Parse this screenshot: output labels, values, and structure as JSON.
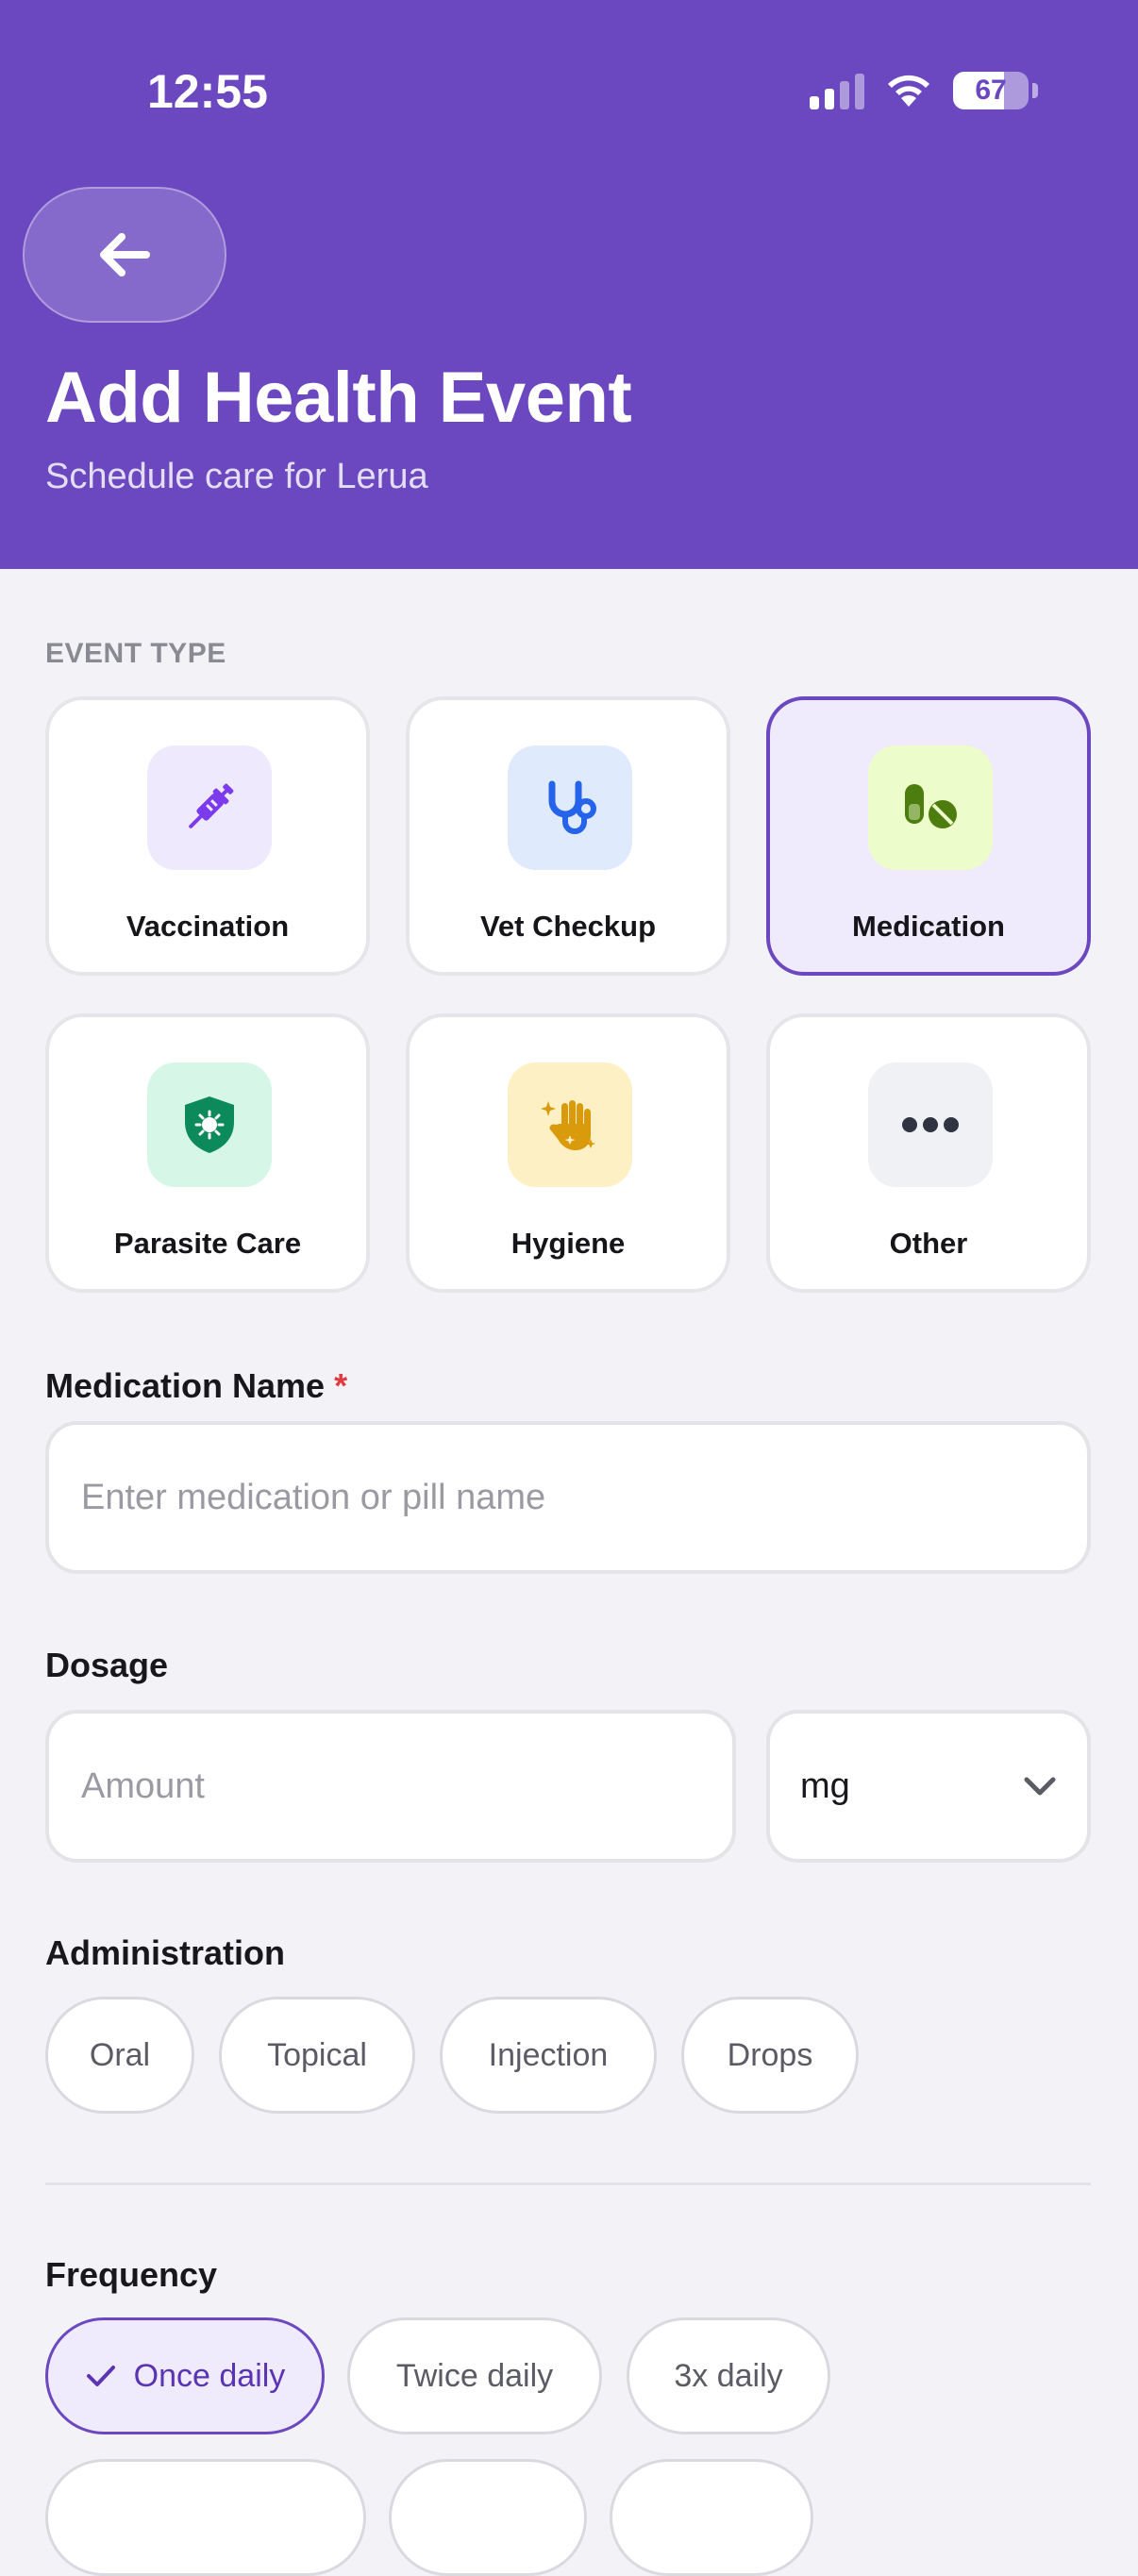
{
  "status_bar": {
    "time": "12:55",
    "battery": "67",
    "battery_level": 0.67
  },
  "header": {
    "title": "Add Health Event",
    "subtitle": "Schedule care for Lerua"
  },
  "event_type": {
    "label": "EVENT TYPE",
    "options": [
      {
        "label": "Vaccination",
        "icon": "syringe-icon",
        "color": "#7c3aed",
        "bg": "#efe9fd",
        "selected": false
      },
      {
        "label": "Vet Checkup",
        "icon": "stethoscope-icon",
        "color": "#2563eb",
        "bg": "#dfeafd",
        "selected": false
      },
      {
        "label": "Medication",
        "icon": "pills-icon",
        "color": "#4d7c0f",
        "bg": "#ecfccb",
        "selected": true
      },
      {
        "label": "Parasite Care",
        "icon": "shield-virus-icon",
        "color": "#0d8a5b",
        "bg": "#d6f7e7",
        "selected": false
      },
      {
        "label": "Hygiene",
        "icon": "hand-sparkles-icon",
        "color": "#d99a0b",
        "bg": "#fdf0c4",
        "selected": false
      },
      {
        "label": "Other",
        "icon": "ellipsis-icon",
        "color": "#2f3440",
        "bg": "#f0f1f4",
        "selected": false
      }
    ]
  },
  "medication_name": {
    "label": "Medication Name",
    "required_mark": "*",
    "placeholder": "Enter medication or pill name",
    "value": ""
  },
  "dosage": {
    "label": "Dosage",
    "amount_placeholder": "Amount",
    "unit": "mg"
  },
  "administration": {
    "label": "Administration",
    "options": [
      "Oral",
      "Topical",
      "Injection",
      "Drops"
    ]
  },
  "frequency": {
    "label": "Frequency",
    "options": [
      "Once daily",
      "Twice daily",
      "3x daily"
    ],
    "selected": "Once daily"
  },
  "colors": {
    "primary": "#6b48c0",
    "required": "#e0393e"
  }
}
